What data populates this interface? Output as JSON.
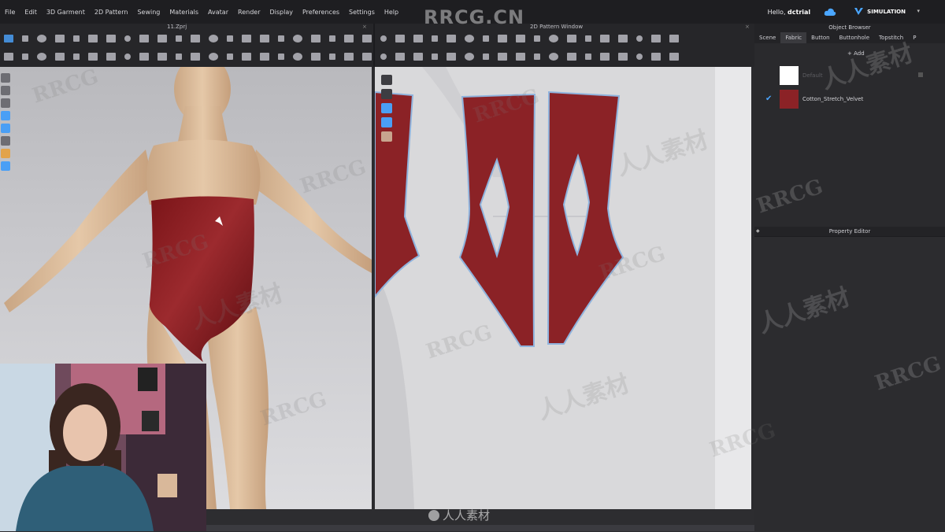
{
  "menu": {
    "items": [
      "File",
      "Edit",
      "3D Garment",
      "2D Pattern",
      "Sewing",
      "Materials",
      "Avatar",
      "Render",
      "Display",
      "Preferences",
      "Settings",
      "Help"
    ],
    "greeting_prefix": "Hello,",
    "username": "dctrial",
    "simulation_label": "SIMULATION"
  },
  "left_window": {
    "title": "11.Zprj"
  },
  "right_window": {
    "title": "2D Pattern Window"
  },
  "object_browser": {
    "title": "Object Browser",
    "tabs": [
      "Scene",
      "Fabric",
      "Button",
      "Buttonhole",
      "Topstitch",
      "P"
    ],
    "active_tab": "Fabric",
    "add_label": "+ Add",
    "fabrics": [
      {
        "name": "Default",
        "color": "#ffffff",
        "checked": false
      },
      {
        "name": "Cotton_Stretch_Velvet",
        "color": "#8b2226",
        "checked": true
      }
    ]
  },
  "property_editor": {
    "title": "Property Editor"
  },
  "garment_color": "#8b2226",
  "accent_color": "#4a9ff5",
  "watermark": {
    "logo": "RRCG.CN",
    "bottom_logo": "人人素材",
    "marks": [
      "RRCG",
      "人人素材"
    ]
  },
  "icons": {
    "cloud": "cloud-sync-icon",
    "simulation": "simulation-icon"
  }
}
